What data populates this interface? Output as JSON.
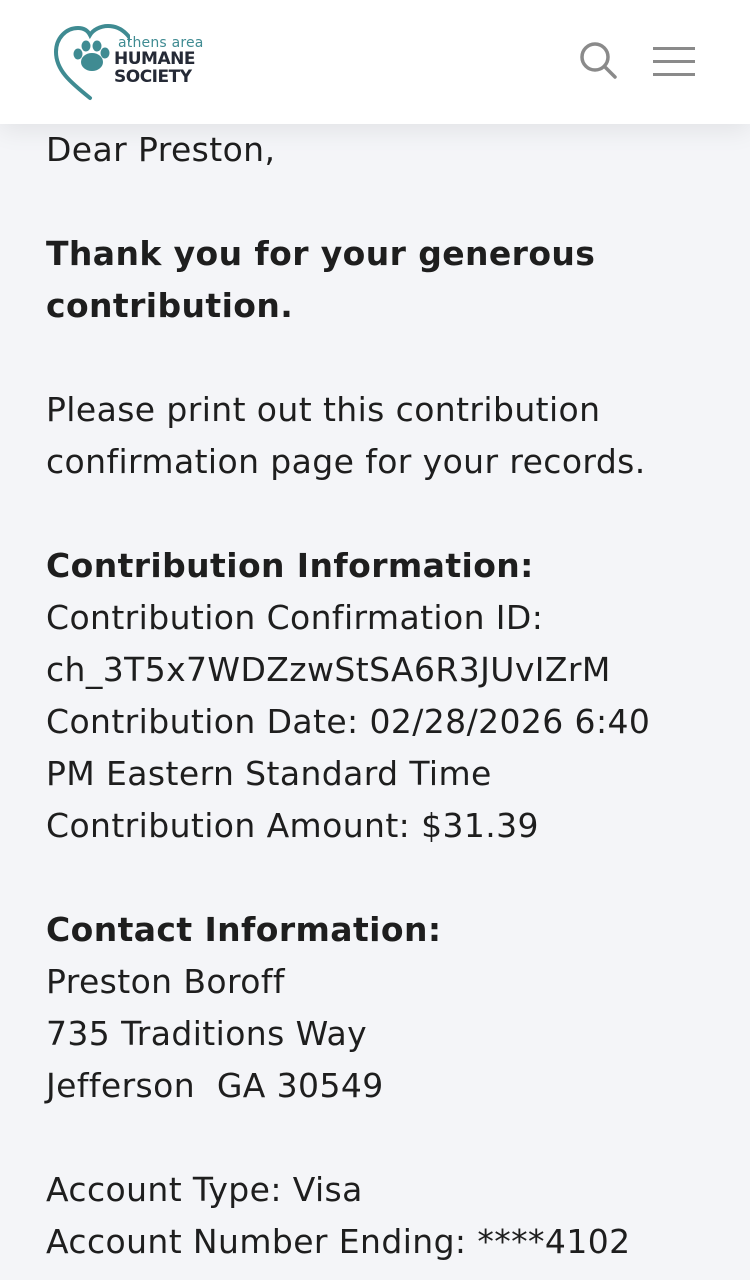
{
  "header": {
    "logo": {
      "small_text": "athens area",
      "line1": "HUMANE",
      "line2": "SOCIETY"
    },
    "search_icon": "search-icon",
    "menu_icon": "hamburger-menu-icon",
    "brand_color": "#3f8b92"
  },
  "letter": {
    "greeting": "Dear Preston,",
    "thanks_line1": "Thank you for your generous",
    "thanks_line2": "contribution.",
    "print_line1": "Please print out this contribution",
    "print_line2": "confirmation page for your records.",
    "contribution_heading": "Contribution Information:",
    "confirmation_label": "Contribution Confirmation ID:",
    "confirmation_id": "ch_3T5x7WDZzwStSA6R3JUvIZrM",
    "date_line1": "Contribution Date: 02/28/2026 6:40",
    "date_line2": "PM Eastern Standard Time",
    "amount_line": "Contribution Amount: $31.39",
    "contact_heading": "Contact Information:",
    "contact_name": "Preston Boroff",
    "contact_street": "735 Traditions Way",
    "contact_city": "Jefferson  GA 30549",
    "account_type": "Account Type: Visa",
    "account_number": "Account Number Ending: ****4102"
  }
}
